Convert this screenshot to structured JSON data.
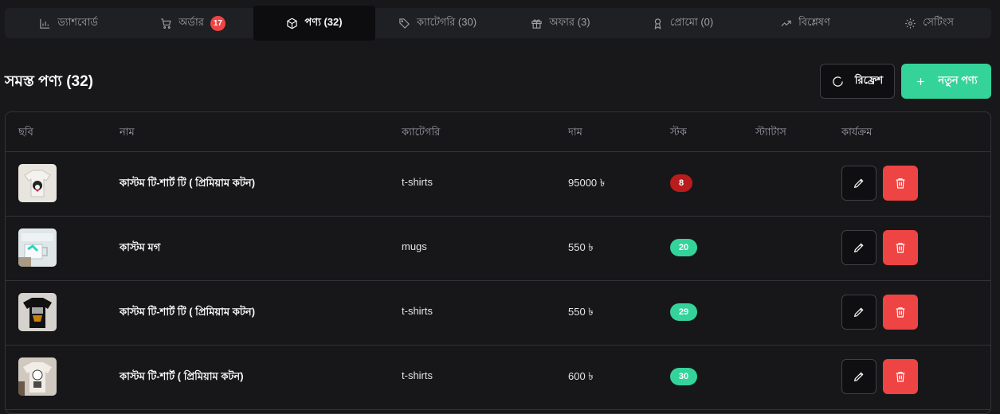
{
  "tabs": [
    {
      "label": "ড্যাশবোর্ড",
      "icon": "bar-chart-icon"
    },
    {
      "label": "অর্ডার",
      "icon": "cart-icon",
      "badge": "17"
    },
    {
      "label": "পণ্য (32)",
      "icon": "box-icon",
      "active": true
    },
    {
      "label": "ক্যাটেগরি (30)",
      "icon": "tag-icon"
    },
    {
      "label": "অফার (3)",
      "icon": "gift-icon"
    },
    {
      "label": "প্রোমো (0)",
      "icon": "award-icon"
    },
    {
      "label": "বিশ্লেষণ",
      "icon": "trending-up-icon"
    },
    {
      "label": "সেটিংস",
      "icon": "gear-icon"
    }
  ],
  "header": {
    "title": "সমস্ত পণ্য (32)",
    "refresh_label": "রিফ্রেশ",
    "new_label": "নতুন পণ্য"
  },
  "table": {
    "columns": [
      "ছবি",
      "নাম",
      "ক্যাটেগরি",
      "দাম",
      "স্টক",
      "স্ট্যাটাস",
      "কার্যক্রম"
    ],
    "rows": [
      {
        "name": "কাস্টম টি-শার্ট টি ( প্রিমিয়াম কটন)",
        "category": "t-shirts",
        "price": "95000 ৳",
        "stock": "8",
        "stock_status": "low"
      },
      {
        "name": "কাস্টম মগ",
        "category": "mugs",
        "price": "550 ৳",
        "stock": "20",
        "stock_status": "ok"
      },
      {
        "name": "কাস্টম টি-শার্ট টি ( প্রিমিয়াম কটন)",
        "category": "t-shirts",
        "price": "550 ৳",
        "stock": "29",
        "stock_status": "ok"
      },
      {
        "name": "কাস্টম টি-শার্ট ( প্রিমিয়াম কটন)",
        "category": "t-shirts",
        "price": "600 ৳",
        "stock": "30",
        "stock_status": "ok"
      }
    ]
  },
  "colors": {
    "background": "#18181b",
    "accent_green": "#34d399",
    "danger_red": "#ef4444",
    "low_stock_red": "#b91c1c"
  }
}
